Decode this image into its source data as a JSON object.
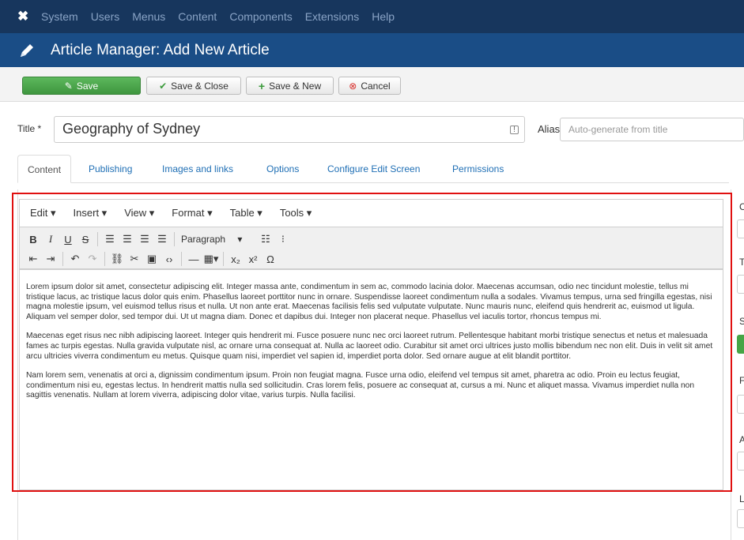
{
  "nav": {
    "logo": "✖",
    "items": [
      "System",
      "Users",
      "Menus",
      "Content",
      "Components",
      "Extensions",
      "Help"
    ]
  },
  "header": {
    "title": "Article Manager: Add New Article"
  },
  "toolbar": {
    "save_label": "Save",
    "save_close_label": "Save & Close",
    "save_new_label": "Save & New",
    "cancel_label": "Cancel"
  },
  "form": {
    "title_label": "Title *",
    "title_value": "Geography of Sydney",
    "alias_label": "Alias",
    "alias_placeholder": "Auto-generate from title"
  },
  "tabs": [
    "Content",
    "Publishing",
    "Images and links",
    "Options",
    "Configure Edit Screen",
    "Permissions"
  ],
  "editor": {
    "menus": [
      "Edit ▾",
      "Insert ▾",
      "View ▾",
      "Format ▾",
      "Table ▾",
      "Tools ▾"
    ],
    "format_select": "Paragraph",
    "paragraphs": [
      "Lorem ipsum dolor sit amet, consectetur adipiscing elit. Integer massa ante, condimentum in sem ac, commodo lacinia dolor. Maecenas accumsan, odio nec tincidunt molestie, tellus mi tristique lacus, ac tristique lacus dolor quis enim. Phasellus laoreet porttitor nunc in ornare. Suspendisse laoreet condimentum nulla a sodales. Vivamus tempus, urna sed fringilla egestas, nisi magna molestie ipsum, vel euismod tellus risus et nulla. Ut non ante erat. Maecenas facilisis felis sed vulputate vulputate. Nunc mauris nunc, eleifend quis hendrerit ac, euismod ut ligula. Aliquam vel semper dolor, sed tempor dui. Ut ut magna diam. Donec et dapibus dui. Integer non placerat neque. Phasellus vel iaculis tortor, rhoncus tempus mi.",
      "Maecenas eget risus nec nibh adipiscing laoreet. Integer quis hendrerit mi. Fusce posuere nunc nec orci laoreet rutrum. Pellentesque habitant morbi tristique senectus et netus et malesuada fames ac turpis egestas. Nulla gravida vulputate nisl, ac ornare urna consequat at. Nulla ac laoreet odio. Curabitur sit amet orci ultrices justo mollis bibendum nec non elit. Duis in velit sit amet arcu ultricies viverra condimentum eu metus. Quisque quam nisi, imperdiet vel sapien id, imperdiet porta dolor. Sed ornare augue at elit blandit porttitor.",
      "Nam lorem sem, venenatis at orci a, dignissim condimentum ipsum. Proin non feugiat magna. Fusce urna odio, eleifend vel tempus sit amet, pharetra ac odio. Proin eu lectus feugiat, condimentum nisi eu, egestas lectus. In hendrerit mattis nulla sed sollicitudin. Cras lorem felis, posuere ac consequat at, cursus a mi. Nunc et aliquet massa. Vivamus imperdiet nulla non sagittis venenatis. Nullam at lorem viverra, adipiscing dolor vitae, varius turpis. Nulla facilisi."
    ]
  },
  "sidebar_fragments": [
    "C",
    "T",
    "S",
    "F",
    "A",
    "L"
  ],
  "colors": {
    "nav_bg": "#17365d",
    "header_bg": "#1a4d86",
    "save_green": "#46a546",
    "highlight_red": "#e01010",
    "link_blue": "#1f6fb5"
  }
}
